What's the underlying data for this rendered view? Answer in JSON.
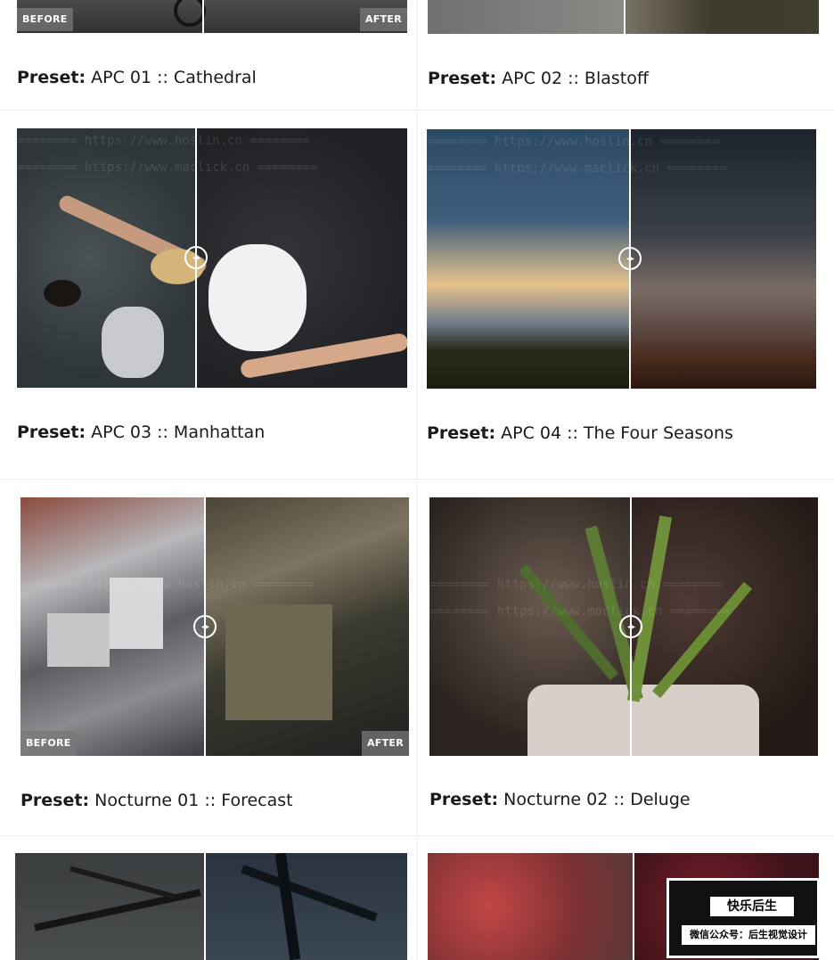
{
  "presets": [
    {
      "prefix": "Preset:",
      "name": "APC 01 :: Cathedral",
      "before_label": "BEFORE",
      "after_label": "AFTER"
    },
    {
      "prefix": "Preset:",
      "name": "APC 02 :: Blastoff"
    },
    {
      "prefix": "Preset:",
      "name": "APC 03 :: Manhattan"
    },
    {
      "prefix": "Preset:",
      "name": "APC 04 :: The Four Seasons"
    },
    {
      "prefix": "Preset:",
      "name": "Nocturne 01 :: Forecast",
      "before_label": "BEFORE",
      "after_label": "AFTER"
    },
    {
      "prefix": "Preset:",
      "name": "Nocturne 02 :: Deluge"
    }
  ],
  "watermarks": {
    "line1": "======== https://www.hoslin.cn ========",
    "line2": "======== https://www.maclick.cn ========"
  },
  "corner_badge": {
    "title": "快乐后生",
    "subtitle": "微信公众号：后生视觉设计"
  },
  "handle_icon": "compare-arrows-icon"
}
